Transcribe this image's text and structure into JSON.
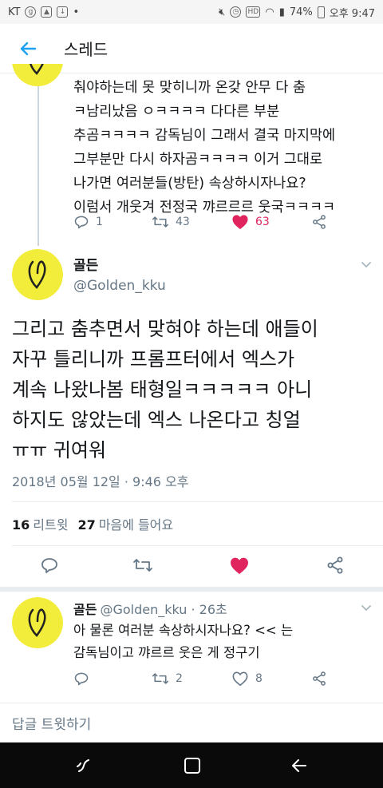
{
  "status_bar": {
    "carrier": "KT",
    "battery": "74%",
    "time": "오후 9:47"
  },
  "header": {
    "title": "스레드"
  },
  "parent_tweet": {
    "text": "춰야하는데 못 맞히니까 온갖 안무 다 춤\nㅋ남리났음 ㅇㅋㅋㅋㅋ 다다른 부분\n추곰ㅋㅋㅋㅋ 감독님이 그래서 결국 마지막에\n그부분만 다시 하자곰ㅋㅋㅋㅋ 이거 그대로\n나가면 여러분들(방탄) 속상하시자나요?\n이럼서 개웃겨 전정국 꺄르르르 웃국ㅋㅋㅋㅋ",
    "reply_count": "1",
    "retweet_count": "43",
    "like_count": "63"
  },
  "main_tweet": {
    "name": "골든",
    "handle": "@Golden_kku",
    "text": "그리고 춤추면서 맞혀야 하는데 애들이\n자꾸 틀리니까 프롬프터에서 엑스가\n계속 나왔나봄 태형일ㅋㅋㅋㅋㅋ 아니\n하지도 않았는데 엑스 나온다고 칭얼\nㅠㅠ 귀여워",
    "date": "2018년 05월 12일 · 9:46 오후",
    "retweets_count": "16",
    "retweets_label": "리트윗",
    "likes_count": "27",
    "likes_label": "마음에 들어요"
  },
  "reply_tweet": {
    "name": "골든",
    "handle_time": "@Golden_kku · 26초",
    "text": "아 물론 여러분 속상하시자나요? << 는\n감독님이고 꺄르르 웃은 게 정구기",
    "retweet_count": "2",
    "like_count": "8"
  },
  "compose": {
    "placeholder": "답글 트윗하기"
  },
  "colors": {
    "accent": "#1da1f2",
    "like": "#e0245e",
    "avatar_bg": "#f2ec3a",
    "muted": "#657786"
  }
}
